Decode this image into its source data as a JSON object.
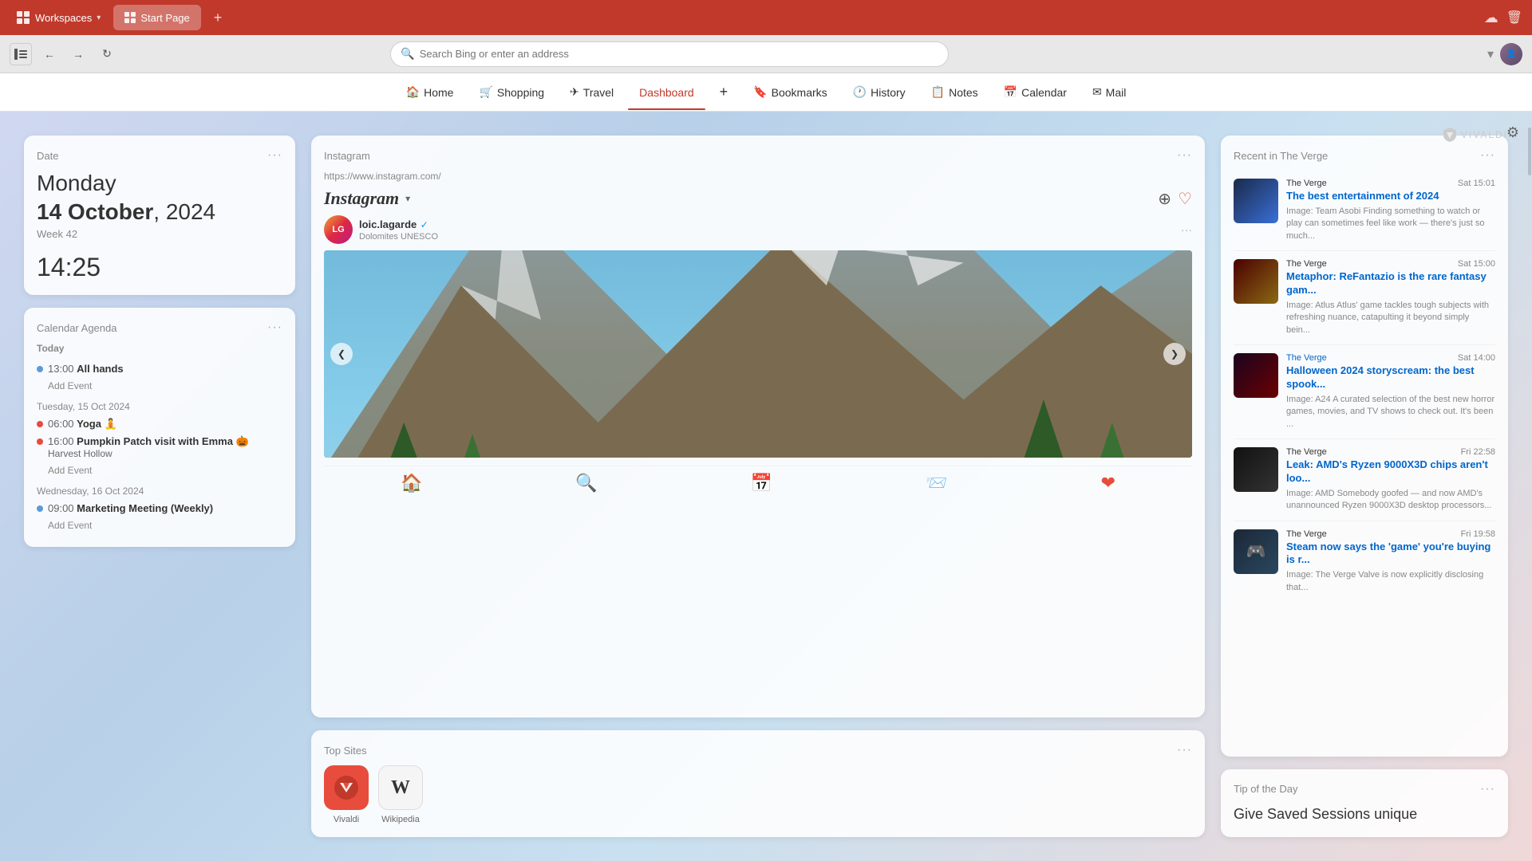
{
  "browser": {
    "tab_bar": {
      "workspaces_label": "Workspaces",
      "tab_label": "Start Page",
      "new_tab_icon": "+",
      "cloud_icon": "☁",
      "trash_icon": "🗑"
    },
    "address_bar": {
      "search_placeholder": "Search Bing or enter an address",
      "back_icon": "←",
      "forward_icon": "→",
      "refresh_icon": "↻"
    },
    "nav": {
      "items": [
        {
          "id": "home",
          "label": "Home",
          "icon": "🏠"
        },
        {
          "id": "shopping",
          "label": "Shopping",
          "icon": "🛒"
        },
        {
          "id": "travel",
          "label": "Travel",
          "icon": "✈"
        },
        {
          "id": "dashboard",
          "label": "Dashboard",
          "icon": "",
          "active": true
        },
        {
          "id": "plus",
          "label": "+",
          "icon": ""
        },
        {
          "id": "bookmarks",
          "label": "Bookmarks",
          "icon": "🔖"
        },
        {
          "id": "history",
          "label": "History",
          "icon": "🕐"
        },
        {
          "id": "notes",
          "label": "Notes",
          "icon": "📋"
        },
        {
          "id": "calendar",
          "label": "Calendar",
          "icon": "📅"
        },
        {
          "id": "mail",
          "label": "Mail",
          "icon": "✉"
        }
      ]
    }
  },
  "widgets": {
    "date": {
      "title": "Date",
      "day": "Monday",
      "date_pre": "14 October",
      "date_year": ", 2024",
      "week": "Week 42",
      "time": "14:25"
    },
    "calendar": {
      "title": "Calendar Agenda",
      "today_label": "Today",
      "events_today": [
        {
          "time": "13:00",
          "name": "All hands",
          "dot": "blue"
        }
      ],
      "add_event_1": "Add Event",
      "tuesday_label": "Tuesday,  15 Oct 2024",
      "events_tuesday": [
        {
          "time": "06:00",
          "name": "Yoga 🧘",
          "dot": "red"
        },
        {
          "time": "16:00",
          "name": "Pumpkin Patch visit with Emma 🎃",
          "sub": "Harvest Hollow",
          "dot": "red"
        }
      ],
      "add_event_2": "Add Event",
      "wednesday_label": "Wednesday,  16 Oct 2024",
      "events_wednesday": [
        {
          "time": "09:00",
          "name": "Marketing Meeting (Weekly)",
          "dot": "blue"
        }
      ],
      "add_event_3": "Add Event"
    },
    "instagram": {
      "title": "Instagram",
      "url": "https://www.instagram.com/",
      "logo": "Instagram",
      "user": "loic.lagarde",
      "verified": "✓",
      "location": "Dolomites UNESCO",
      "nav_prev": "❮",
      "nav_next": "❯",
      "footer_icons": [
        "🏠",
        "🔍",
        "📅",
        "📨",
        "❤"
      ]
    },
    "verge": {
      "title": "Recent in The Verge",
      "articles": [
        {
          "source": "The Verge",
          "time": "Sat 15:01",
          "title": "The best entertainment of 2024",
          "desc": "Image: Team Asobi Finding something to watch or play can sometimes feel like work — there's just so much...",
          "thumb_class": "thumb-entertainment"
        },
        {
          "source": "The Verge",
          "time": "Sat 15:00",
          "title": "Metaphor: ReFantazio is the rare fantasy gam...",
          "desc": "Image: Atlus Atlus' game tackles tough subjects with refreshing nuance, catapulting it beyond simply bein...",
          "thumb_class": "thumb-fantasy"
        },
        {
          "source": "The Verge",
          "time": "Sat 14:00",
          "title": "Halloween 2024 storyscream: the best spook...",
          "desc": "Image: A24 A curated selection of the best new horror games, movies, and TV shows to check out. It's been ...",
          "thumb_class": "thumb-halloween"
        },
        {
          "source": "The Verge",
          "time": "Fri 22:58",
          "title": "Leak: AMD's Ryzen 9000X3D chips aren't loo...",
          "desc": "Image: AMD Somebody goofed — and now AMD's unannounced Ryzen 9000X3D desktop processors...",
          "thumb_class": "thumb-amd"
        },
        {
          "source": "The Verge",
          "time": "Fri 19:58",
          "title": "Steam now says the 'game' you're buying is r...",
          "desc": "Image: The Verge Valve is now explicitly disclosing that...",
          "thumb_class": "thumb-steam"
        }
      ]
    },
    "top_sites": {
      "title": "Top Sites",
      "sites": [
        {
          "label": "Vivaldi",
          "bg": "#e74c3c",
          "icon": "V"
        },
        {
          "label": "Wikipedia",
          "bg": "#f5f5f5",
          "icon": "W",
          "border": "1px solid #ddd"
        }
      ]
    },
    "tip": {
      "title": "Tip of the Day",
      "content": "Give Saved Sessions unique"
    }
  },
  "vivaldi": {
    "logo_text": "VIVALDI"
  }
}
